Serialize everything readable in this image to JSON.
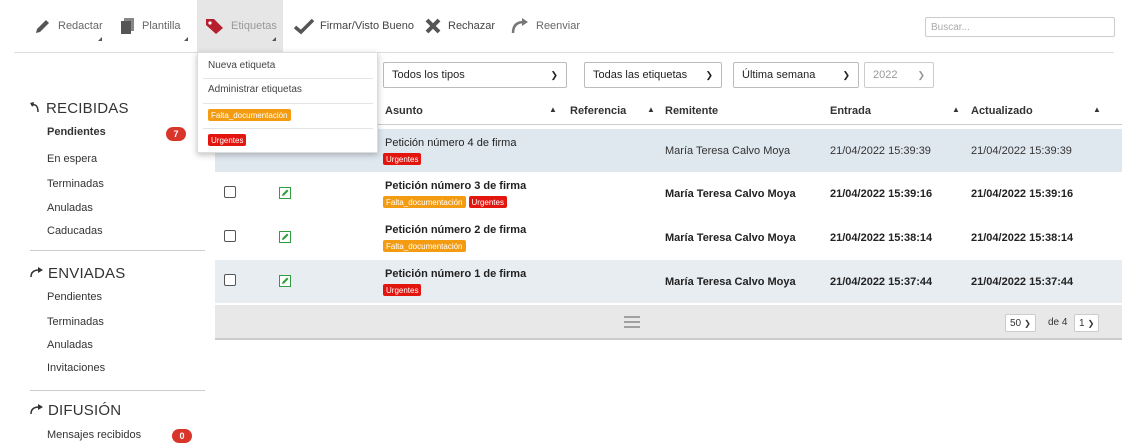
{
  "toolbar": {
    "redactar": "Redactar",
    "plantilla": "Plantilla",
    "etiquetas": "Etiquetas",
    "firmar": "Firmar/Visto Bueno",
    "rechazar": "Rechazar",
    "reenviar": "Reenviar",
    "search_placeholder": "Buscar..."
  },
  "menu": {
    "nueva": "Nueva etiqueta",
    "administrar": "Administrar etiquetas",
    "tag1": "Falta_documentación",
    "tag2": "Urgentes"
  },
  "sidebar": {
    "recibidas": {
      "title": "RECIBIDAS",
      "items": [
        "Pendientes",
        "En espera",
        "Terminadas",
        "Anuladas",
        "Caducadas"
      ],
      "pending_count": "7"
    },
    "enviadas": {
      "title": "ENVIADAS",
      "items": [
        "Pendientes",
        "Terminadas",
        "Anuladas",
        "Invitaciones"
      ]
    },
    "difusion": {
      "title": "DIFUSIÓN",
      "items": [
        "Mensajes recibidos"
      ],
      "count": "0"
    }
  },
  "filters": {
    "tipos": "Todos los tipos",
    "etiquetas": "Todas las etiquetas",
    "periodo": "Última semana",
    "year": "2022"
  },
  "table": {
    "columns": [
      "Asunto",
      "Referencia",
      "Remitente",
      "Entrada",
      "Actualizado"
    ],
    "rows": [
      {
        "asunto": "Petición número 4 de firma",
        "tags": [
          "Urgentes"
        ],
        "remitente": "María Teresa Calvo Moya",
        "entrada": "21/04/2022 15:39:39",
        "actualizado": "21/04/2022 15:39:39"
      },
      {
        "asunto": "Petición número 3 de firma",
        "tags": [
          "Falta_documentación",
          "Urgentes"
        ],
        "remitente": "María Teresa Calvo Moya",
        "entrada": "21/04/2022 15:39:16",
        "actualizado": "21/04/2022 15:39:16"
      },
      {
        "asunto": "Petición número 2 de firma",
        "tags": [
          "Falta_documentación"
        ],
        "remitente": "María Teresa Calvo Moya",
        "entrada": "21/04/2022 15:38:14",
        "actualizado": "21/04/2022 15:38:14"
      },
      {
        "asunto": "Petición número 1 de firma",
        "tags": [
          "Urgentes"
        ],
        "remitente": "María Teresa Calvo Moya",
        "entrada": "21/04/2022 15:37:44",
        "actualizado": "21/04/2022 15:37:44"
      }
    ]
  },
  "pagination": {
    "per_page": "50",
    "of_label": "de 4",
    "page": "1"
  },
  "colors": {
    "urgentes": "#e3150f",
    "falta": "#f39c12",
    "badge": "#d9362b",
    "edit_icon": "#2e9e3e"
  }
}
